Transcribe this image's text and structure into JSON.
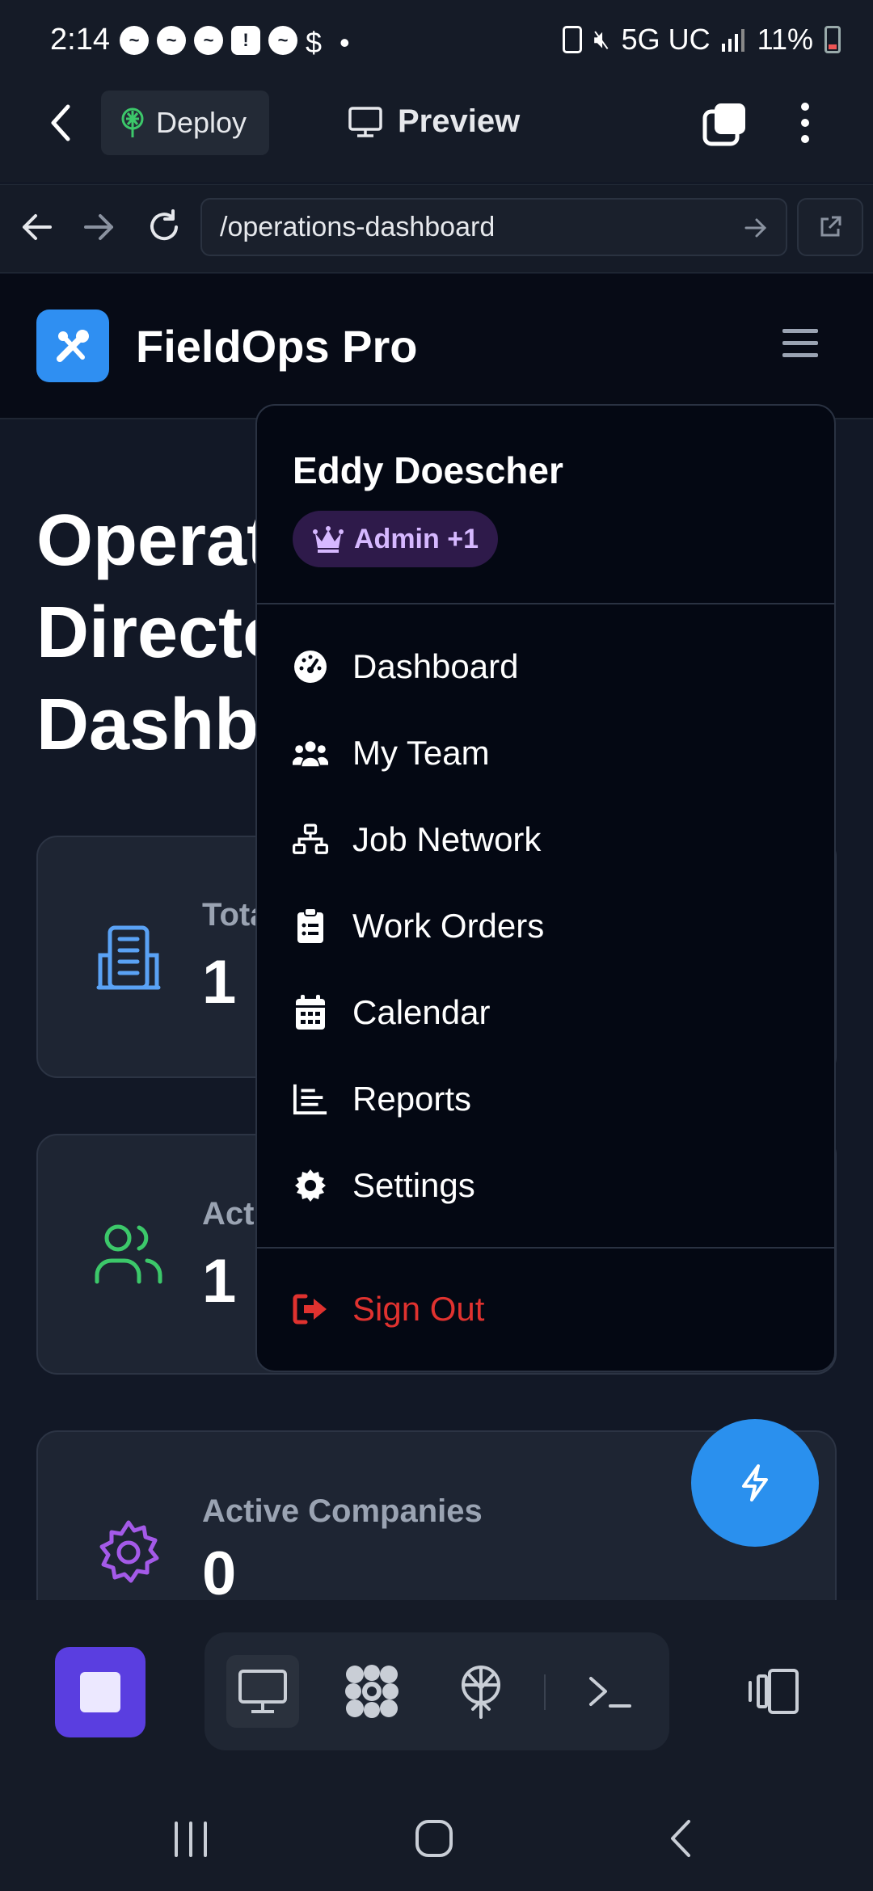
{
  "status_bar": {
    "time": "2:14",
    "network": "5G UC",
    "battery": "11%"
  },
  "app_bar": {
    "deploy_label": "Deploy",
    "preview_label": "Preview"
  },
  "browser": {
    "url": "/operations-dashboard"
  },
  "site": {
    "brand": "FieldOps Pro",
    "brand_color": "#2f8ff2"
  },
  "page": {
    "title_line1": "Operat",
    "title_line2": "Directo",
    "title_line3": "Dashbo"
  },
  "cards": [
    {
      "label": "Tota",
      "value": "1",
      "icon": "building-icon",
      "color": "#5aa2f5"
    },
    {
      "label": "Acti",
      "value": "1",
      "icon": "users-icon",
      "color": "#3cc86a"
    },
    {
      "label": "Active Companies",
      "value": "0",
      "icon": "gear-icon",
      "color": "#a45ae8"
    }
  ],
  "dropdown": {
    "user_name": "Eddy Doescher",
    "role_badge": "Admin +1",
    "items": [
      {
        "label": "Dashboard",
        "icon": "gauge-icon"
      },
      {
        "label": "My Team",
        "icon": "team-icon"
      },
      {
        "label": "Job Network",
        "icon": "network-icon"
      },
      {
        "label": "Work Orders",
        "icon": "clipboard-icon"
      },
      {
        "label": "Calendar",
        "icon": "calendar-icon"
      },
      {
        "label": "Reports",
        "icon": "chart-icon"
      },
      {
        "label": "Settings",
        "icon": "gear-icon"
      }
    ],
    "sign_out": "Sign Out",
    "sign_out_color": "#e0322f"
  }
}
